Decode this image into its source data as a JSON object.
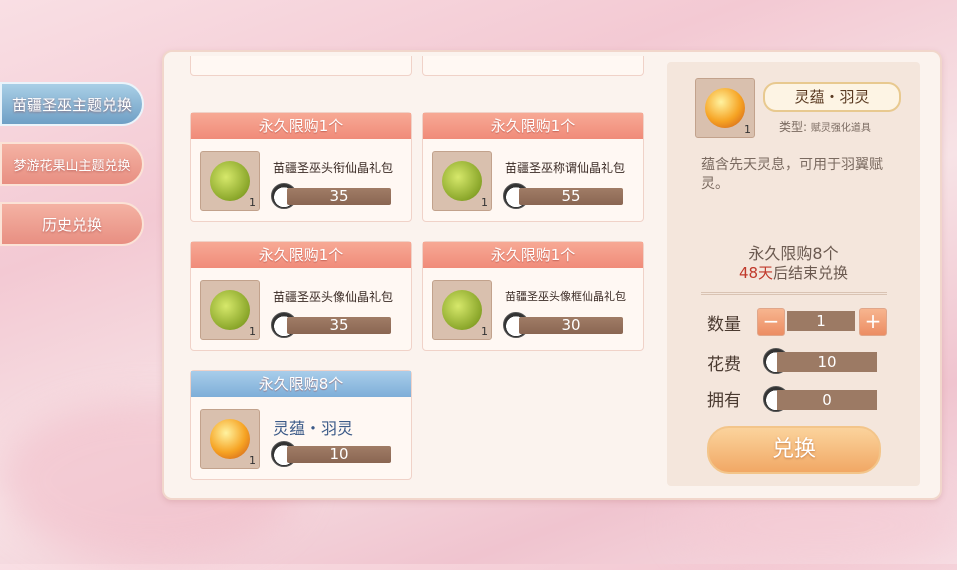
{
  "tabs": [
    {
      "label": "苗疆圣巫主题兑换",
      "active": true
    },
    {
      "label": "梦游花果山主题兑换",
      "active": false
    },
    {
      "label": "历史兑换",
      "active": false
    }
  ],
  "items": [
    {
      "limit": "永久限购1个",
      "name": "苗疆圣巫头衔仙晶礼包",
      "qty": "1",
      "price": "35",
      "icon": "lucky-bag-icon",
      "style": "pink"
    },
    {
      "limit": "永久限购1个",
      "name": "苗疆圣巫称谓仙晶礼包",
      "qty": "1",
      "price": "55",
      "icon": "lucky-bag-icon",
      "style": "pink"
    },
    {
      "limit": "永久限购1个",
      "name": "苗疆圣巫头像仙晶礼包",
      "qty": "1",
      "price": "35",
      "icon": "lucky-bag-icon",
      "style": "pink"
    },
    {
      "limit": "永久限购1个",
      "name": "苗疆圣巫头像框仙晶礼包",
      "qty": "1",
      "price": "30",
      "icon": "lucky-bag-icon",
      "style": "pink"
    },
    {
      "limit": "永久限购8个",
      "name": "灵蕴・羽灵",
      "qty": "1",
      "price": "10",
      "icon": "spirit-orb-icon",
      "style": "blue"
    }
  ],
  "detail": {
    "title": "灵蕴・羽灵",
    "qty": "1",
    "type_label": "类型:",
    "type_value": "赋灵强化道具",
    "description": "蕴含先天灵息，可用于羽翼赋灵。",
    "limit": "永久限购8个",
    "end_days": "48天",
    "end_suffix": "后结束兑换",
    "quantity_label": "数量",
    "quantity_value": "1",
    "cost_label": "花费",
    "cost_value": "10",
    "own_label": "拥有",
    "own_value": "0",
    "minus": "−",
    "plus": "+",
    "exchange_label": "兑换"
  },
  "colors": {
    "accent_pink": "#f08b79",
    "accent_blue": "#7eaed8",
    "price_bar": "#8a6652",
    "deadline_red": "#c0392b"
  }
}
